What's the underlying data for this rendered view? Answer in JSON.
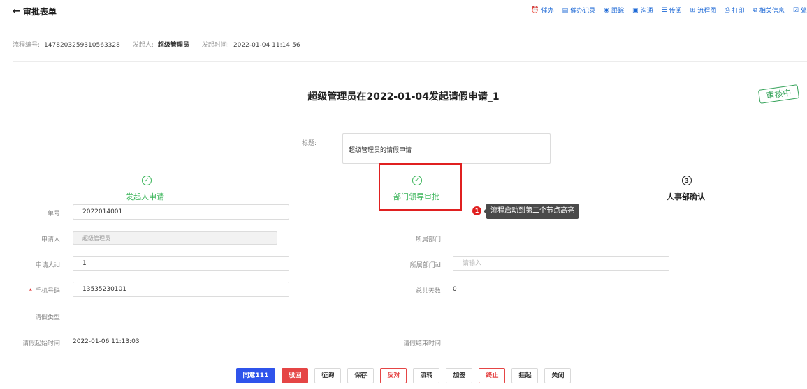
{
  "header": {
    "back_label": "审批表单",
    "tools": [
      {
        "icon": "⏰",
        "label": "催办",
        "name": "tool-urge"
      },
      {
        "icon": "▤",
        "label": "催办记录",
        "name": "tool-urge-log"
      },
      {
        "icon": "◉",
        "label": "跟踪",
        "name": "tool-track"
      },
      {
        "icon": "▣",
        "label": "沟通",
        "name": "tool-communicate"
      },
      {
        "icon": "☰",
        "label": "传阅",
        "name": "tool-circulate"
      },
      {
        "icon": "⊞",
        "label": "流程图",
        "name": "tool-flowchart"
      },
      {
        "icon": "⎙",
        "label": "打印",
        "name": "tool-print"
      },
      {
        "icon": "⧉",
        "label": "相关信息",
        "name": "tool-related"
      },
      {
        "icon": "☑",
        "label": "处",
        "name": "tool-handle"
      }
    ]
  },
  "meta": {
    "flow_no_label": "流程编号:",
    "flow_no": "1478203259310563328",
    "initiator_label": "发起人:",
    "initiator": "超级管理员",
    "time_label": "发起时间:",
    "time": "2022-01-04 11:14:56"
  },
  "form_title": "超级管理员在2022-01-04发起请假申请_1",
  "stamp": "审核中",
  "title_field": {
    "label": "标题:",
    "value": "超级管理员的请假申请"
  },
  "steps": [
    {
      "label": "发起人申请",
      "status": "done",
      "symbol": "✓"
    },
    {
      "label": "部门领导审批",
      "status": "done",
      "symbol": "✓"
    },
    {
      "label": "人事部确认",
      "status": "todo",
      "symbol": "3"
    }
  ],
  "annotation": {
    "number": "1",
    "text": "流程启动到第二个节点高亮"
  },
  "fields": {
    "order_no": {
      "label": "单号:",
      "value": "2022014001"
    },
    "applicant": {
      "label": "申请人:",
      "value": "超级管理员"
    },
    "dept": {
      "label": "所属部门:",
      "value": ""
    },
    "applicant_id": {
      "label": "申请人id:",
      "value": "1"
    },
    "dept_id": {
      "label": "所属部门id:",
      "placeholder": "请输入"
    },
    "phone": {
      "label": "手机号码:",
      "required": "*",
      "value": "13535230101"
    },
    "total_days": {
      "label": "总共天数:",
      "value": "0"
    },
    "leave_type": {
      "label": "请假类型:"
    },
    "start_time": {
      "label": "请假起始时间:",
      "value": "2022-01-06 11:13:03"
    },
    "end_time": {
      "label": "请假结束时间:"
    }
  },
  "buttons": [
    {
      "label": "同意111",
      "style": "primary",
      "name": "agree-button"
    },
    {
      "label": "驳回",
      "style": "danger",
      "name": "reject-button"
    },
    {
      "label": "征询",
      "style": "default",
      "name": "consult-button"
    },
    {
      "label": "保存",
      "style": "default",
      "name": "save-button"
    },
    {
      "label": "反对",
      "style": "red-outline",
      "name": "oppose-button"
    },
    {
      "label": "流转",
      "style": "default",
      "name": "transfer-button"
    },
    {
      "label": "加签",
      "style": "default",
      "name": "add-sign-button"
    },
    {
      "label": "终止",
      "style": "red-outline",
      "name": "terminate-button"
    },
    {
      "label": "挂起",
      "style": "default",
      "name": "suspend-button"
    },
    {
      "label": "关闭",
      "style": "default",
      "name": "close-button"
    }
  ],
  "colors": {
    "accent": "#1f6ad6",
    "done": "#3bb55a",
    "highlight": "#e02020"
  }
}
